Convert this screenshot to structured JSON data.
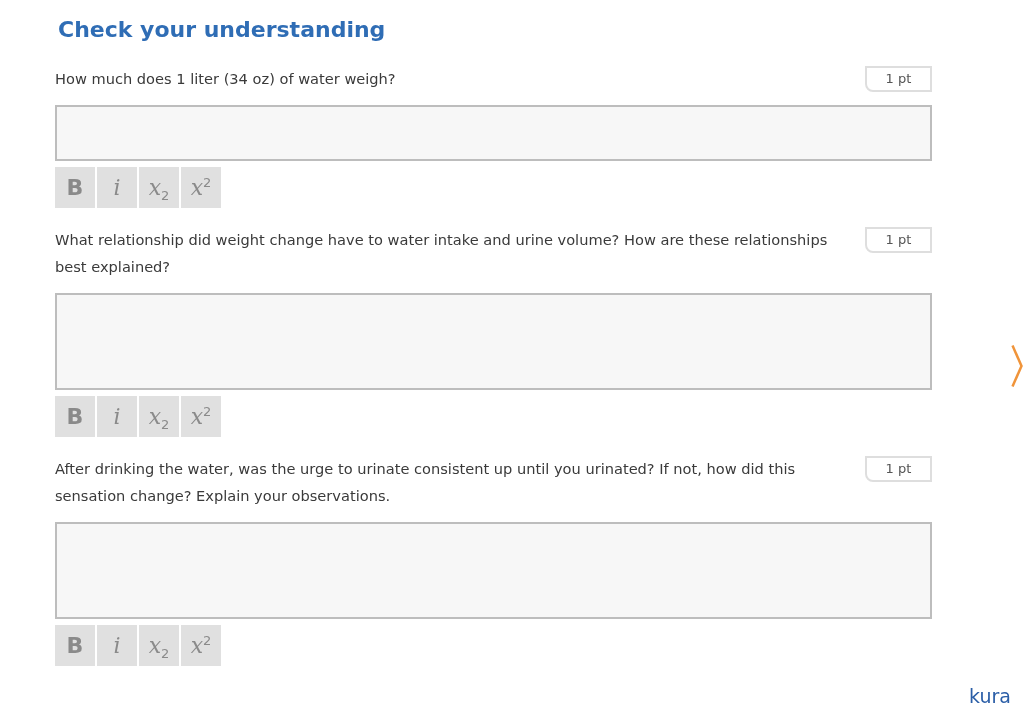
{
  "title": "Check your understanding",
  "questions": [
    {
      "prompt": "How much does 1 liter (34 oz) of water weigh?",
      "points": "1 pt",
      "kind": "short",
      "toolbar": [
        {
          "label": "B",
          "kind": "bold"
        },
        {
          "label": "i",
          "kind": "italic"
        },
        {
          "label": "x$_{2}$",
          "kind": "subscript"
        },
        {
          "label": "x$^{2}$",
          "kind": "superscript"
        }
      ]
    },
    {
      "prompt": "What relationship did weight change have to water intake and urine volume? How are these relationships best explained?",
      "points": "1 pt",
      "kind": "long",
      "toolbar": [
        {
          "label": "B",
          "kind": "bold"
        },
        {
          "label": "i",
          "kind": "italic"
        },
        {
          "label": "x$_{2}$",
          "kind": "subscript"
        },
        {
          "label": "x$^{2}$",
          "kind": "superscript"
        }
      ]
    },
    {
      "prompt": "After drinking the water, was the urge to urinate consistent up until you urinated? If not, how did this sensation change? Explain your observations.",
      "points": "1 pt",
      "kind": "long",
      "toolbar": [
        {
          "label": "B",
          "kind": "bold"
        },
        {
          "label": "i",
          "kind": "italic"
        },
        {
          "label": "x$_{2}$",
          "kind": "subscript"
        },
        {
          "label": "x$^{2}$",
          "kind": "superscript"
        }
      ]
    }
  ],
  "logo": "kura"
}
